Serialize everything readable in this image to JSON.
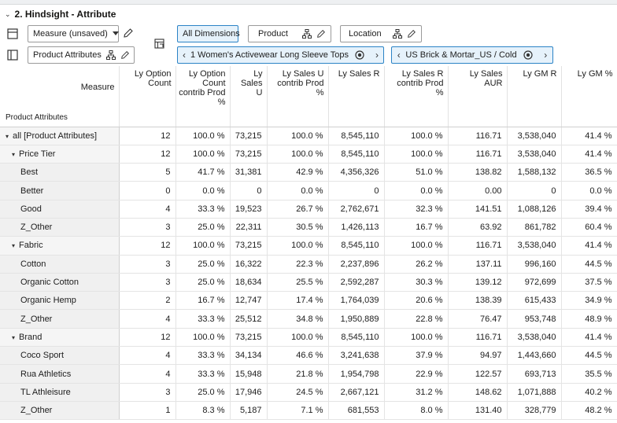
{
  "title": {
    "chevron": "⌄",
    "text": "2. Hindsight - Attribute"
  },
  "toolbar": {
    "measure_select": "Measure (unsaved)",
    "product_attributes": "Product Attributes",
    "all_dimensions": "All Dimensions",
    "product": "Product",
    "location": "Location",
    "product_nav": "1 Women's Activewear Long Sleeve Tops",
    "location_nav": "US Brick & Mortar_US / Cold"
  },
  "grid": {
    "measure_label": "Measure",
    "row_header_label": "Product Attributes",
    "columns": [
      "Ly Option Count",
      "Ly Option Count contrib Prod %",
      "Ly Sales U",
      "Ly Sales U contrib Prod %",
      "Ly Sales R",
      "Ly Sales R contrib Prod %",
      "Ly Sales AUR",
      "Ly GM R",
      "Ly GM %"
    ],
    "rows": [
      {
        "label": "all [Product Attributes]",
        "level": 0,
        "twisty": "▾",
        "values": [
          "12",
          "100.0 %",
          "73,215",
          "100.0 %",
          "8,545,110",
          "100.0 %",
          "116.71",
          "3,538,040",
          "41.4 %"
        ]
      },
      {
        "label": "Price Tier",
        "level": 1,
        "twisty": "▾",
        "values": [
          "12",
          "100.0 %",
          "73,215",
          "100.0 %",
          "8,545,110",
          "100.0 %",
          "116.71",
          "3,538,040",
          "41.4 %"
        ]
      },
      {
        "label": "Best",
        "level": 2,
        "values": [
          "5",
          "41.7 %",
          "31,381",
          "42.9 %",
          "4,356,326",
          "51.0 %",
          "138.82",
          "1,588,132",
          "36.5 %"
        ]
      },
      {
        "label": "Better",
        "level": 2,
        "values": [
          "0",
          "0.0 %",
          "0",
          "0.0 %",
          "0",
          "0.0 %",
          "0.00",
          "0",
          "0.0 %"
        ]
      },
      {
        "label": "Good",
        "level": 2,
        "values": [
          "4",
          "33.3 %",
          "19,523",
          "26.7 %",
          "2,762,671",
          "32.3 %",
          "141.51",
          "1,088,126",
          "39.4 %"
        ]
      },
      {
        "label": "Z_Other",
        "level": 2,
        "values": [
          "3",
          "25.0 %",
          "22,311",
          "30.5 %",
          "1,426,113",
          "16.7 %",
          "63.92",
          "861,782",
          "60.4 %"
        ]
      },
      {
        "label": "Fabric",
        "level": 1,
        "twisty": "▾",
        "values": [
          "12",
          "100.0 %",
          "73,215",
          "100.0 %",
          "8,545,110",
          "100.0 %",
          "116.71",
          "3,538,040",
          "41.4 %"
        ]
      },
      {
        "label": "Cotton",
        "level": 2,
        "values": [
          "3",
          "25.0 %",
          "16,322",
          "22.3 %",
          "2,237,896",
          "26.2 %",
          "137.11",
          "996,160",
          "44.5 %"
        ]
      },
      {
        "label": "Organic Cotton",
        "level": 2,
        "values": [
          "3",
          "25.0 %",
          "18,634",
          "25.5 %",
          "2,592,287",
          "30.3 %",
          "139.12",
          "972,699",
          "37.5 %"
        ]
      },
      {
        "label": "Organic Hemp",
        "level": 2,
        "values": [
          "2",
          "16.7 %",
          "12,747",
          "17.4 %",
          "1,764,039",
          "20.6 %",
          "138.39",
          "615,433",
          "34.9 %"
        ]
      },
      {
        "label": "Z_Other",
        "level": 2,
        "values": [
          "4",
          "33.3 %",
          "25,512",
          "34.8 %",
          "1,950,889",
          "22.8 %",
          "76.47",
          "953,748",
          "48.9 %"
        ]
      },
      {
        "label": "Brand",
        "level": 1,
        "twisty": "▾",
        "values": [
          "12",
          "100.0 %",
          "73,215",
          "100.0 %",
          "8,545,110",
          "100.0 %",
          "116.71",
          "3,538,040",
          "41.4 %"
        ]
      },
      {
        "label": "Coco Sport",
        "level": 2,
        "values": [
          "4",
          "33.3 %",
          "34,134",
          "46.6 %",
          "3,241,638",
          "37.9 %",
          "94.97",
          "1,443,660",
          "44.5 %"
        ]
      },
      {
        "label": "Rua Athletics",
        "level": 2,
        "values": [
          "4",
          "33.3 %",
          "15,948",
          "21.8 %",
          "1,954,798",
          "22.9 %",
          "122.57",
          "693,713",
          "35.5 %"
        ]
      },
      {
        "label": "TL Athleisure",
        "level": 2,
        "values": [
          "3",
          "25.0 %",
          "17,946",
          "24.5 %",
          "2,667,121",
          "31.2 %",
          "148.62",
          "1,071,888",
          "40.2 %"
        ]
      },
      {
        "label": "Z_Other",
        "level": 2,
        "values": [
          "1",
          "8.3 %",
          "5,187",
          "7.1 %",
          "681,553",
          "8.0 %",
          "131.40",
          "328,779",
          "48.2 %"
        ]
      }
    ]
  }
}
